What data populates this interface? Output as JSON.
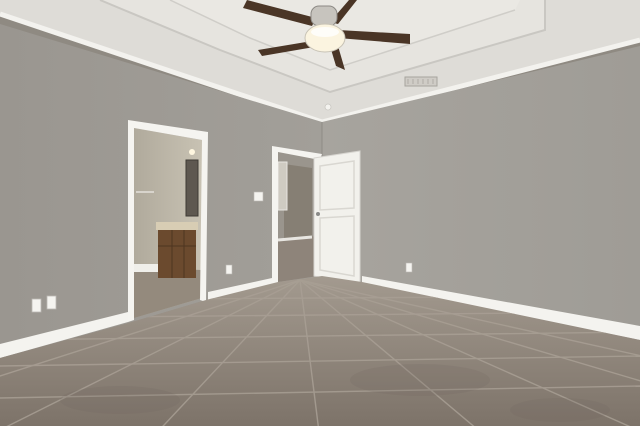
{
  "scene": {
    "subject": "empty-bedroom-interior",
    "colors": {
      "wall_left": "#9d9a94",
      "wall_right": "#a3a09a",
      "ceiling": "#dcdad5",
      "trim": "#f4f3ef",
      "floor": "#8b8279",
      "grout": "#a49b90",
      "door": "#f2f1ec",
      "cabinet": "#6b4a2e",
      "fan_blade": "#4a3526"
    },
    "icons": [
      "ceiling-fan-icon",
      "air-vent-icon",
      "outlet-icon",
      "light-switch-icon",
      "door-knob-icon"
    ]
  }
}
